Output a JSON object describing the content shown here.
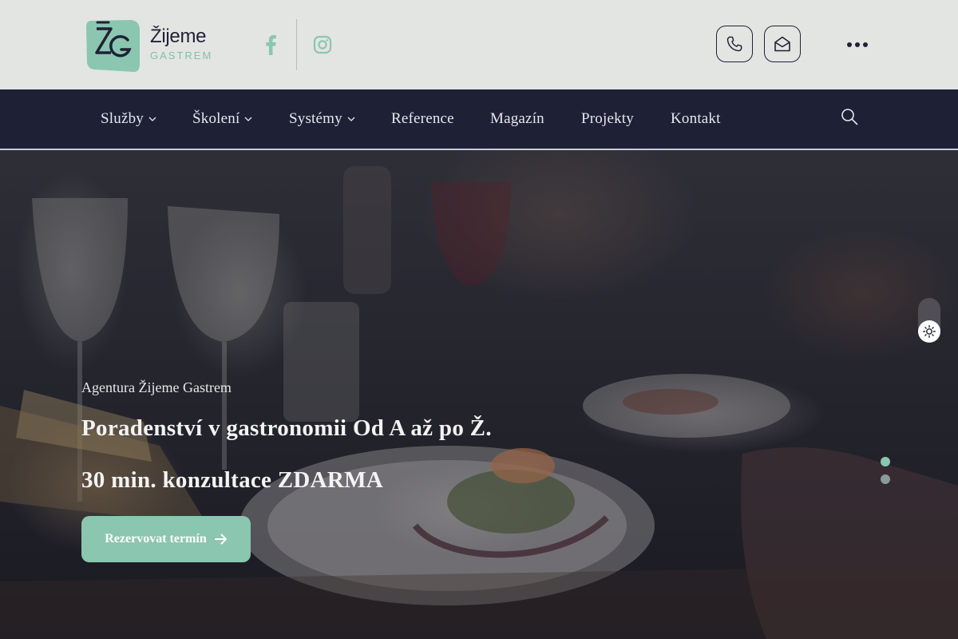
{
  "brand": {
    "name": "Žijeme",
    "sub": "GASTREM",
    "mark_letters": "ŽG",
    "colors": {
      "accent": "#8bc6b0",
      "dark": "#1e2036"
    }
  },
  "header": {
    "social": [
      {
        "icon": "facebook-icon"
      },
      {
        "icon": "instagram-icon"
      }
    ],
    "actions": [
      {
        "icon": "phone-icon"
      },
      {
        "icon": "mail-icon"
      },
      {
        "icon": "more-horizontal-icon"
      }
    ]
  },
  "nav": {
    "items": [
      {
        "label": "Služby",
        "has_dropdown": true
      },
      {
        "label": "Školení",
        "has_dropdown": true
      },
      {
        "label": "Systémy",
        "has_dropdown": true
      },
      {
        "label": "Reference",
        "has_dropdown": false
      },
      {
        "label": "Magazín",
        "has_dropdown": false
      },
      {
        "label": "Projekty",
        "has_dropdown": false
      },
      {
        "label": "Kontakt",
        "has_dropdown": false
      }
    ],
    "search_icon": "search-icon"
  },
  "hero": {
    "kicker": "Agentura Žijeme Gastrem",
    "title": "Poradenství v gastronomii Od A až po Ž.",
    "subtitle": "30 min. konzultace ZDARMA",
    "cta_label": "Rezervovat termín",
    "slides": {
      "count": 2,
      "active": 1
    }
  },
  "theme_toggle": {
    "icon": "sun-icon"
  }
}
